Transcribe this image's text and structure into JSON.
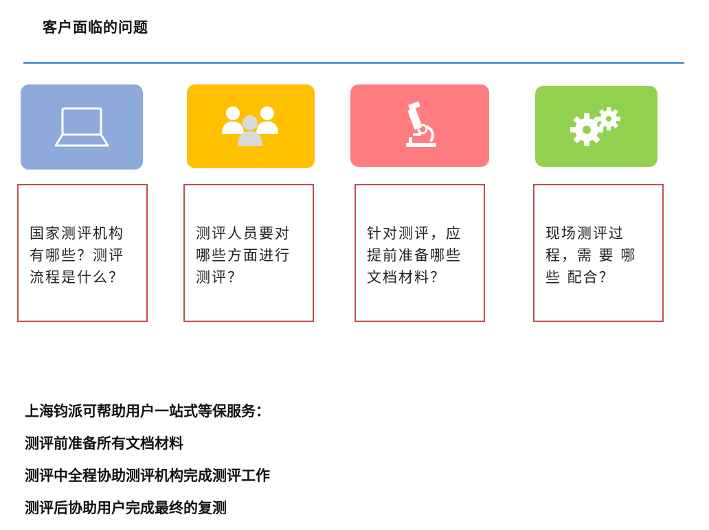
{
  "title": "客户面临的问题",
  "colors": {
    "divider": "#5b9bd5",
    "box_border": "#c0504d",
    "tile_blue": "#8eaadb",
    "tile_yellow": "#ffc000",
    "tile_red": "#ff7c80",
    "tile_green": "#92d050"
  },
  "cards": [
    {
      "icon": "laptop-icon",
      "question": "国家测评机构有哪些？测评流程是什么？"
    },
    {
      "icon": "people-icon",
      "question": "测评人员要对哪些方面进行测评？"
    },
    {
      "icon": "microscope-icon",
      "question": "针对测评，应提前准备哪些文档材料？"
    },
    {
      "icon": "gears-icon",
      "question": "现场测评过程，需 要 哪 些 配合？"
    }
  ],
  "services": {
    "heading": "上海钧派可帮助用户一站式等保服务：",
    "items": [
      "测评前准备所有文档材料",
      "测评中全程协助测评机构完成测评工作",
      "测评后协助用户完成最终的复测"
    ]
  }
}
